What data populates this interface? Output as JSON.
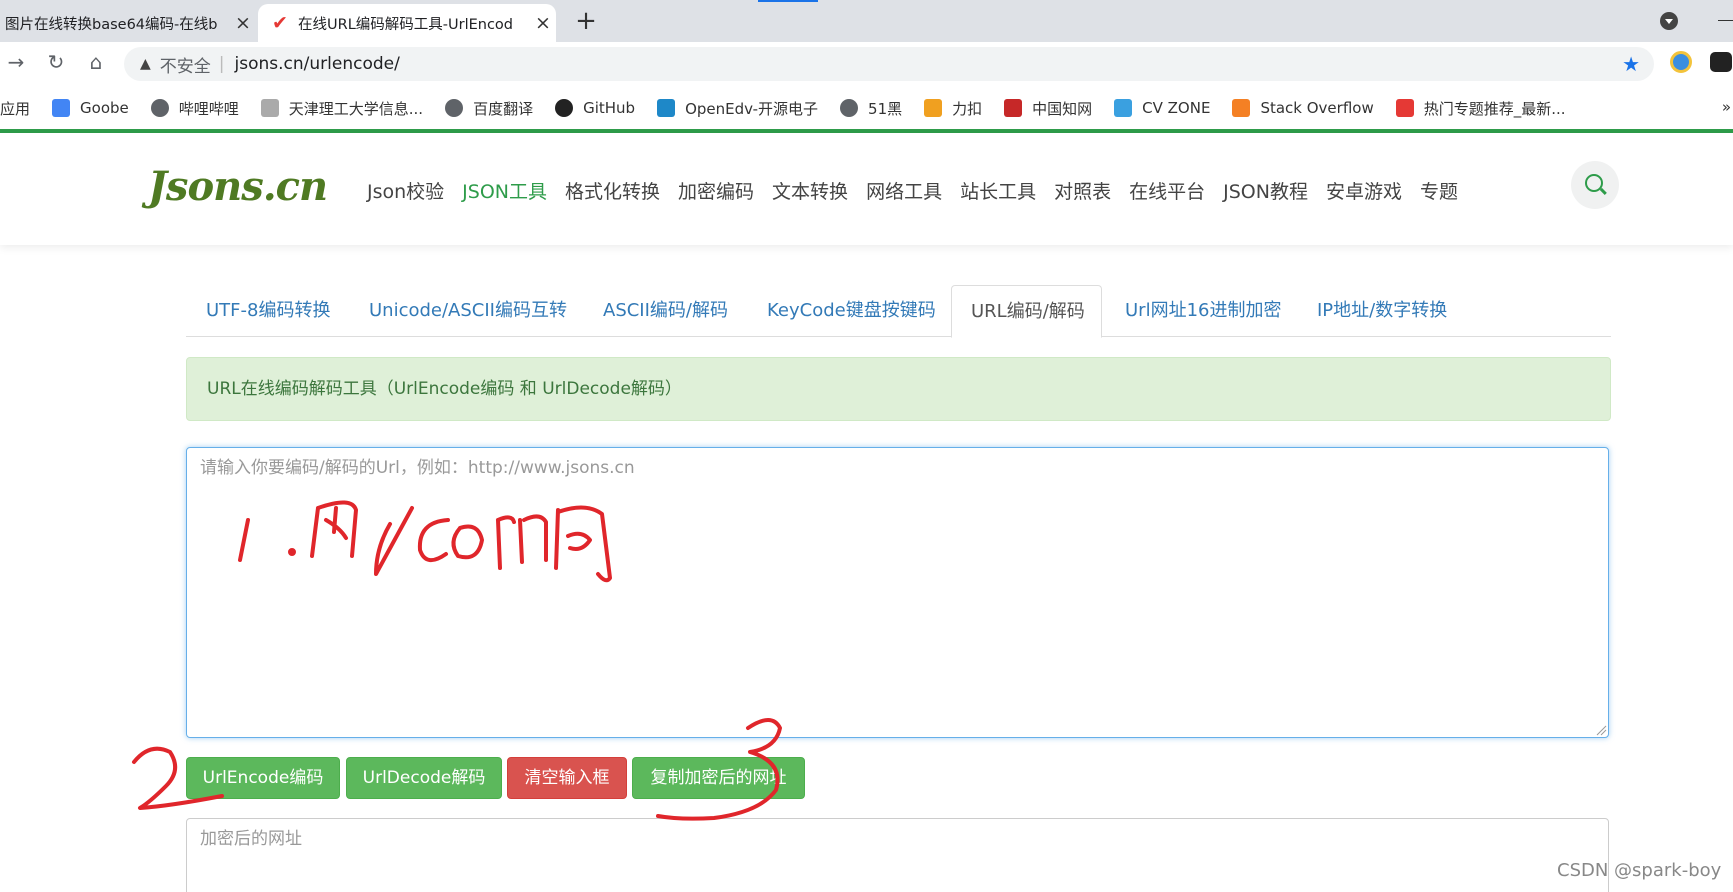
{
  "browser": {
    "tabs": [
      {
        "title": "图片在线转换base64编码-在线b",
        "active": false
      },
      {
        "title": "在线URL编码解码工具-UrlEncod",
        "active": true
      }
    ],
    "address": {
      "insecure_label": "不安全",
      "url": "jsons.cn/urlencode/"
    },
    "bookmarks": [
      "应用",
      "Goobe",
      "哔哩哔哩",
      "天津理工大学信息...",
      "百度翻译",
      "GitHub",
      "OpenEdv-开源电子",
      "51黑",
      "力扣",
      "中国知网",
      "CV ZONE",
      "Stack Overflow",
      "热门专题推荐_最新..."
    ],
    "bookmarks_more": "»"
  },
  "site": {
    "logo": "Jsons.cn",
    "nav": [
      "Json校验",
      "JSON工具",
      "格式化转换",
      "加密编码",
      "文本转换",
      "网络工具",
      "站长工具",
      "对照表",
      "在线平台",
      "JSON教程",
      "安卓游戏",
      "专题"
    ],
    "nav_active": "JSON工具"
  },
  "tool": {
    "tabs": [
      "UTF-8编码转换",
      "Unicode/ASCII编码互转",
      "ASCII编码/解码",
      "KeyCode键盘按键码",
      "URL编码/解码",
      "Url网址16进制加密",
      "IP地址/数字转换"
    ],
    "active_tab": "URL编码/解码",
    "alert": "URL在线编码解码工具（UrlEncode编码 和 UrlDecode解码）",
    "input_placeholder": "请输入你要编码/解码的Url，例如：http://www.jsons.cn",
    "buttons": {
      "encode": "UrlEncode编码",
      "decode": "UrlDecode解码",
      "clear": "清空输入框",
      "copy": "复制加密后的网址"
    },
    "output_placeholder": "加密后的网址"
  },
  "watermark": "CSDN @spark-boy",
  "colors": {
    "brand_green": "#2e9c4a",
    "button_green": "#5cb85c",
    "button_red": "#d9534f",
    "link_blue": "#337ab7",
    "annotation_red": "#e0262b"
  }
}
